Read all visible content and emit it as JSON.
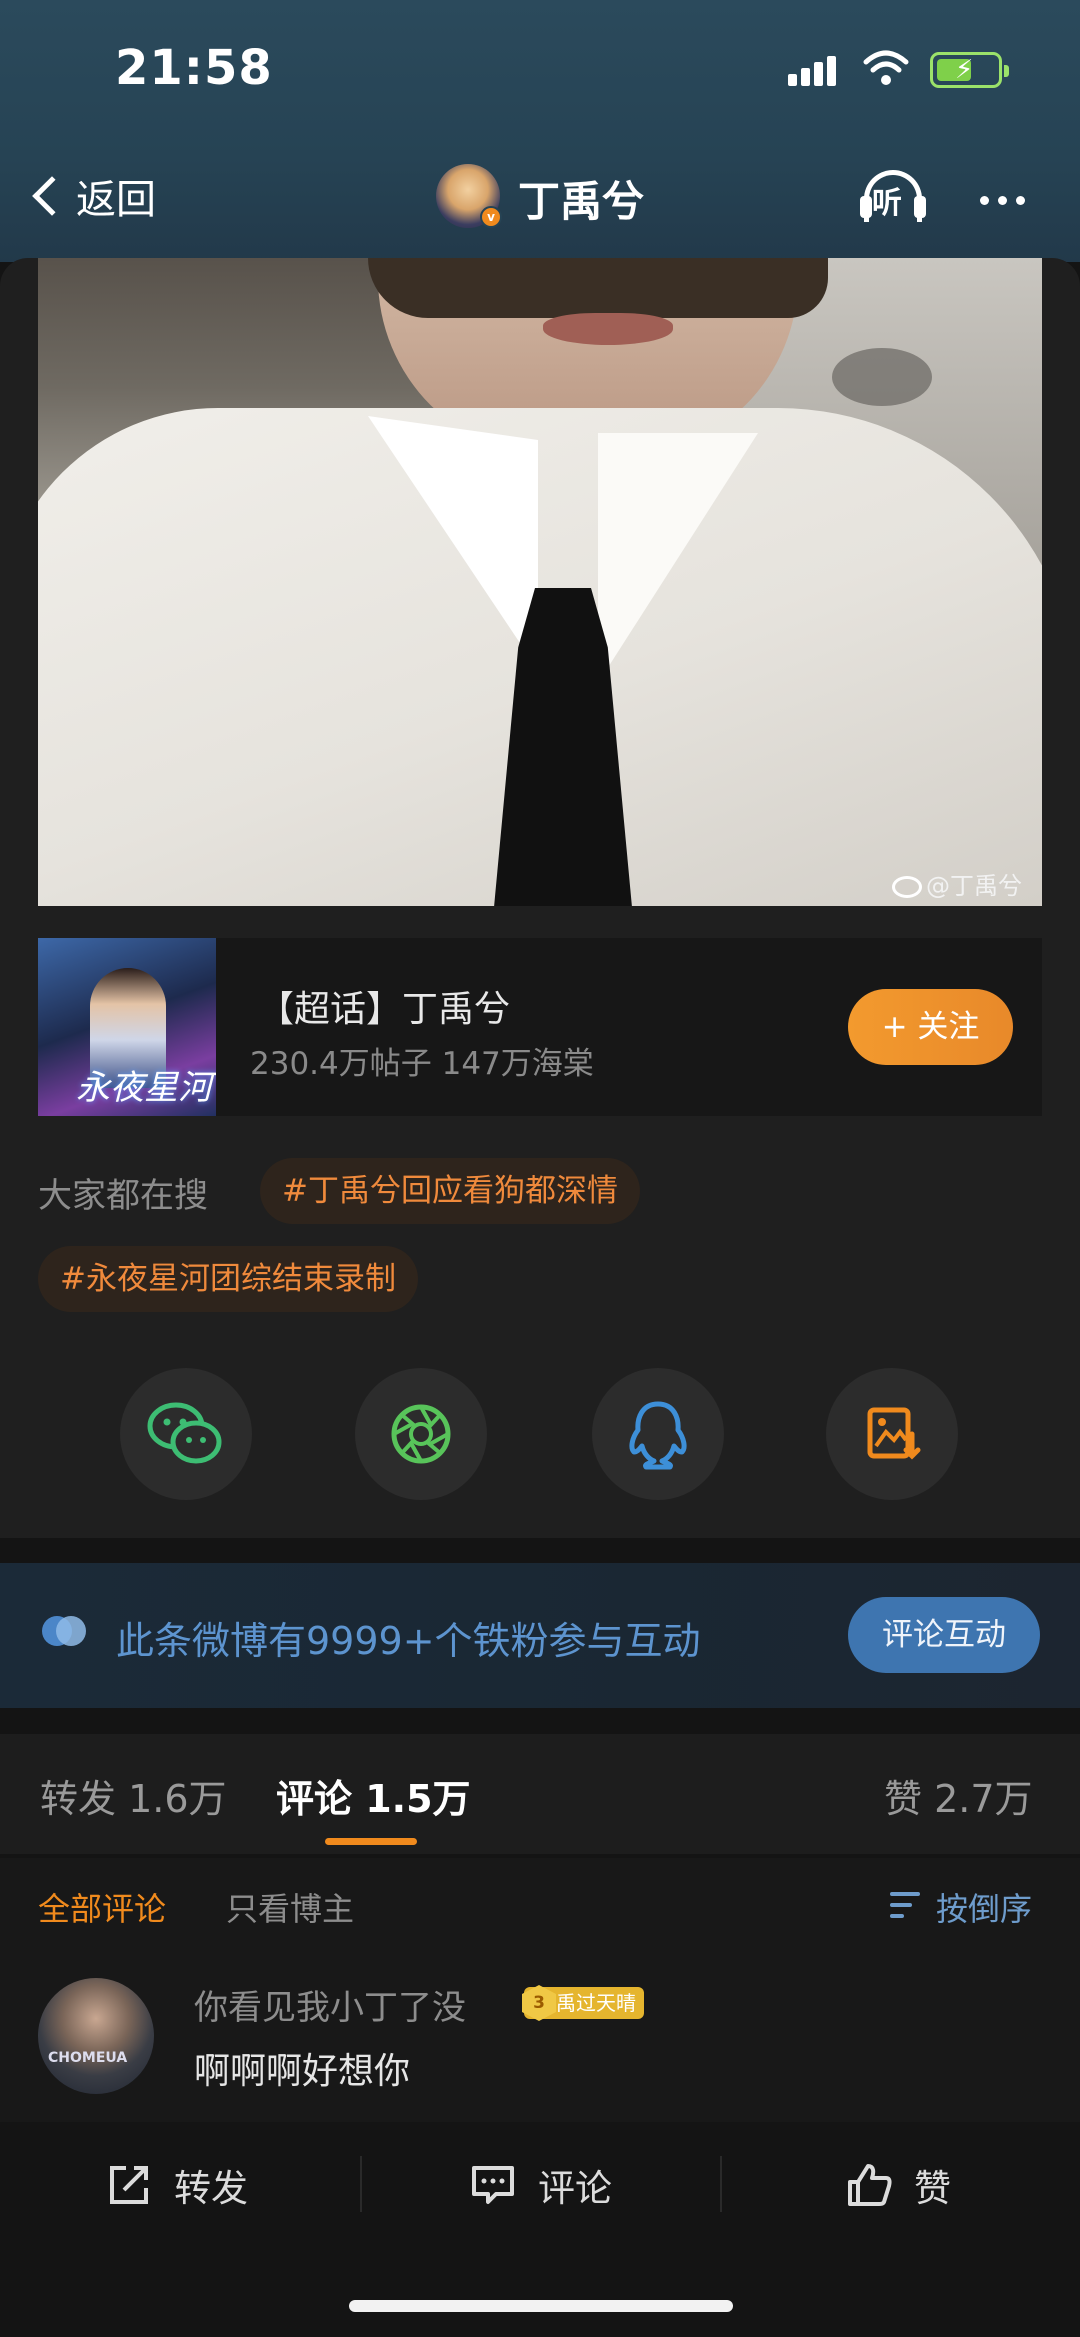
{
  "status_bar": {
    "time": "21:58"
  },
  "nav": {
    "back_label": "返回",
    "title": "丁禹兮",
    "listen_label": "听"
  },
  "photo": {
    "watermark": "@丁禹兮"
  },
  "supertopic": {
    "cover_logo": "永夜星河",
    "title": "【超话】丁禹兮",
    "stats": "230.4万帖子 147万海棠",
    "follow_label": "+ 关注"
  },
  "searches": {
    "label": "大家都在搜",
    "tags": [
      "#丁禹兮回应看狗都深情",
      "#永夜星河团综结束录制"
    ]
  },
  "share_icons": [
    "wechat-icon",
    "moments-icon",
    "qq-icon",
    "save-image-icon"
  ],
  "fans_banner": {
    "text": "此条微博有9999+个铁粉参与互动",
    "button": "评论互动"
  },
  "stats_tabs": {
    "repost": "转发 1.6万",
    "comment": "评论 1.5万",
    "like": "赞 2.7万"
  },
  "filter": {
    "all": "全部评论",
    "owner_only": "只看博主",
    "sort": "按倒序"
  },
  "comment": {
    "username": "你看见我小丁了没",
    "badge_level": "3",
    "badge_text": "禹过天晴",
    "text": "啊啊啊好想你",
    "avatar_text": "CHOMEUA"
  },
  "bottom_bar": {
    "repost": "转发",
    "comment": "评论",
    "like": "赞"
  },
  "colors": {
    "accent": "#f08a1d",
    "blue": "#3e75b0",
    "bg": "#141414"
  }
}
